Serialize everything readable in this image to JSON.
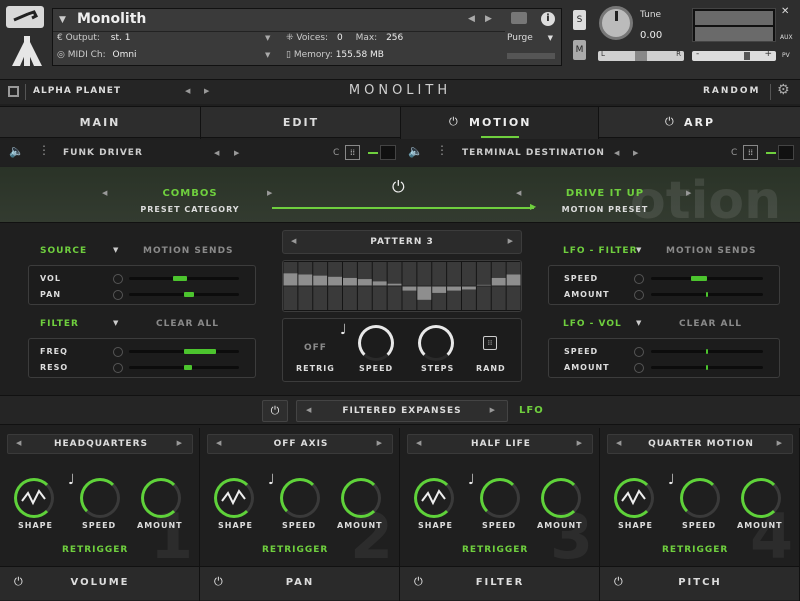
{
  "kontakt": {
    "instrument_name": "Monolith",
    "output_label": "Output:",
    "output_value": "st. 1",
    "midi_label": "MIDI Ch:",
    "midi_value": "Omni",
    "voices_label": "Voices:",
    "voices_value": "0",
    "max_label": "Max:",
    "max_value": "256",
    "memory_label": "Memory:",
    "memory_value": "155.58 MB",
    "purge_label": "Purge",
    "solo_label": "S",
    "mute_label": "M",
    "tune_label": "Tune",
    "tune_value": "0.00",
    "pan_left": "L",
    "pan_right": "R",
    "aux_label": "AUX",
    "pv_label": "PV",
    "minus": "-",
    "plus": "+"
  },
  "topbar": {
    "preset_name": "ALPHA PLANET",
    "title": "MONOLITH",
    "random_label": "RANDOM"
  },
  "tabs": [
    "MAIN",
    "EDIT",
    "MOTION",
    "ARP"
  ],
  "slots": {
    "left_name": "FUNK DRIVER",
    "right_name": "TERMINAL DESTINATION",
    "c_label": "C"
  },
  "preset_bar": {
    "category_value": "COMBOS",
    "category_label": "PRESET CATEGORY",
    "motion_value": "DRIVE IT UP",
    "motion_label": "MOTION PRESET",
    "watermark": "otion"
  },
  "left_panel": {
    "source_label": "SOURCE",
    "sends_label": "MOTION SENDS",
    "vol_label": "VOL",
    "pan_label": "PAN",
    "filter_label": "FILTER",
    "clear_label": "CLEAR ALL",
    "freq_label": "FREQ",
    "reso_label": "RESO"
  },
  "pattern": {
    "name": "PATTERN 3",
    "off_label": "OFF",
    "retrig_label": "RETRIG",
    "speed_label": "SPEED",
    "steps_label": "STEPS",
    "rand_label": "RAND",
    "steps": [
      0.55,
      0.5,
      0.45,
      0.4,
      0.35,
      0.3,
      0.2,
      0.1,
      -0.2,
      -0.6,
      -0.3,
      -0.2,
      -0.15,
      0.05,
      0.35,
      0.5
    ]
  },
  "right_panel": {
    "lfo_filter_label": "LFO - FILTER",
    "sends_label": "MOTION SENDS",
    "speed_label": "SPEED",
    "amount_label": "AMOUNT",
    "lfo_vol_label": "LFO - VOL",
    "clear_label": "CLEAR ALL",
    "speed2_label": "SPEED",
    "amount2_label": "AMOUNT"
  },
  "lfo_bar": {
    "preset_name": "FILTERED EXPANSES",
    "lfo_label": "LFO"
  },
  "lfos": [
    {
      "name": "HEADQUARTERS",
      "num": "1",
      "shape": "SHAPE",
      "speed": "SPEED",
      "amount": "AMOUNT",
      "retrigger": "RETRIGGER",
      "bottom": "VOLUME"
    },
    {
      "name": "OFF AXIS",
      "num": "2",
      "shape": "SHAPE",
      "speed": "SPEED",
      "amount": "AMOUNT",
      "retrigger": "RETRIGGER",
      "bottom": "PAN"
    },
    {
      "name": "HALF LIFE",
      "num": "3",
      "shape": "SHAPE",
      "speed": "SPEED",
      "amount": "AMOUNT",
      "retrigger": "RETRIGGER",
      "bottom": "FILTER"
    },
    {
      "name": "QUARTER MOTION",
      "num": "4",
      "shape": "SHAPE",
      "speed": "SPEED",
      "amount": "AMOUNT",
      "retrigger": "RETRIGGER",
      "bottom": "PITCH"
    }
  ],
  "colors": {
    "accent": "#6fcf3e",
    "background": "#1f1f1f"
  }
}
